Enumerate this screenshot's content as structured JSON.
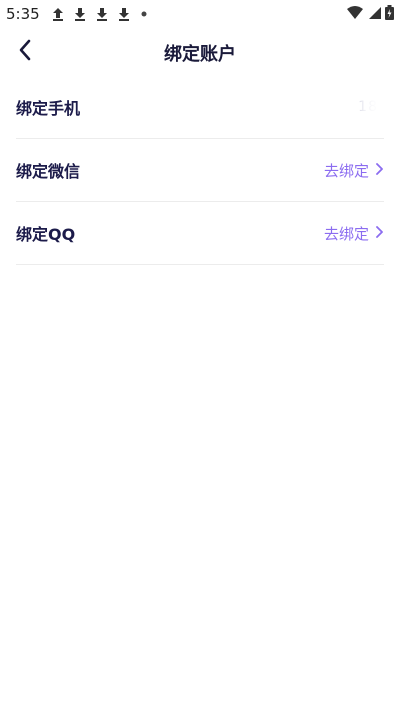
{
  "status_bar": {
    "time": "5:35",
    "notification_icons": [
      "upload-icon",
      "download-icon",
      "download-icon",
      "download-icon",
      "dot-icon"
    ],
    "right_icons": [
      "wifi-icon",
      "signal-icon",
      "battery-icon"
    ]
  },
  "nav": {
    "title": "绑定账户",
    "back_icon": "chevron-left-icon"
  },
  "rows": [
    {
      "label": "绑定手机",
      "value": "18",
      "action": ""
    },
    {
      "label": "绑定微信",
      "value": "",
      "action": "去绑定"
    },
    {
      "label": "绑定QQ",
      "value": "",
      "action": "去绑定"
    }
  ],
  "colors": {
    "accent": "#8b6cf0",
    "label": "#1c1b4a",
    "divider": "#ececec",
    "background": "#ffffff"
  }
}
